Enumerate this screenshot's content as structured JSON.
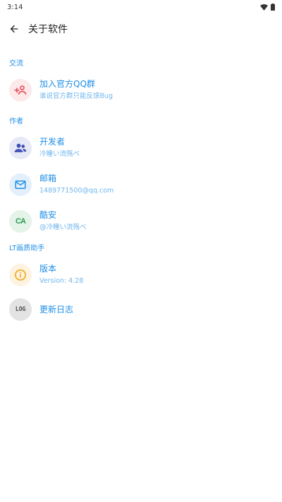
{
  "status": {
    "time": "3:14"
  },
  "toolbar": {
    "title": "关于软件"
  },
  "sections": {
    "communication": {
      "label": "交流"
    },
    "author": {
      "label": "作者"
    },
    "app": {
      "label": "LT画质助手"
    }
  },
  "items": {
    "qq_group": {
      "title": "加入官方QQ群",
      "subtitle": "谁说官方群只能反馈Bug",
      "icon": "add-group-icon",
      "color": "#e8505b",
      "bg": "#fde8ea"
    },
    "developer": {
      "title": "开发者",
      "subtitle": "冷瞳い流殇べ",
      "icon": "people-icon",
      "color": "#3f51b5",
      "bg": "#e7e9f6"
    },
    "email": {
      "title": "邮箱",
      "subtitle": "1489771500@qq.com",
      "icon": "mail-icon",
      "color": "#1f8ee6",
      "bg": "#e3f0fc"
    },
    "coolapk": {
      "title": "酷安",
      "subtitle": "@冷瞳い流殇べ",
      "icon": "coolapk-icon",
      "icon_text": "CA",
      "color": "#2e9a55",
      "bg": "#e4f4e8"
    },
    "version": {
      "title": "版本",
      "subtitle": "Version: 4.28",
      "icon": "info-icon",
      "color": "#f2a71b",
      "bg": "#fdf3e0"
    },
    "changelog": {
      "title": "更新日志",
      "icon": "log-icon",
      "icon_text": "LOG",
      "color": "#555555",
      "bg": "#e3e3e3"
    }
  }
}
